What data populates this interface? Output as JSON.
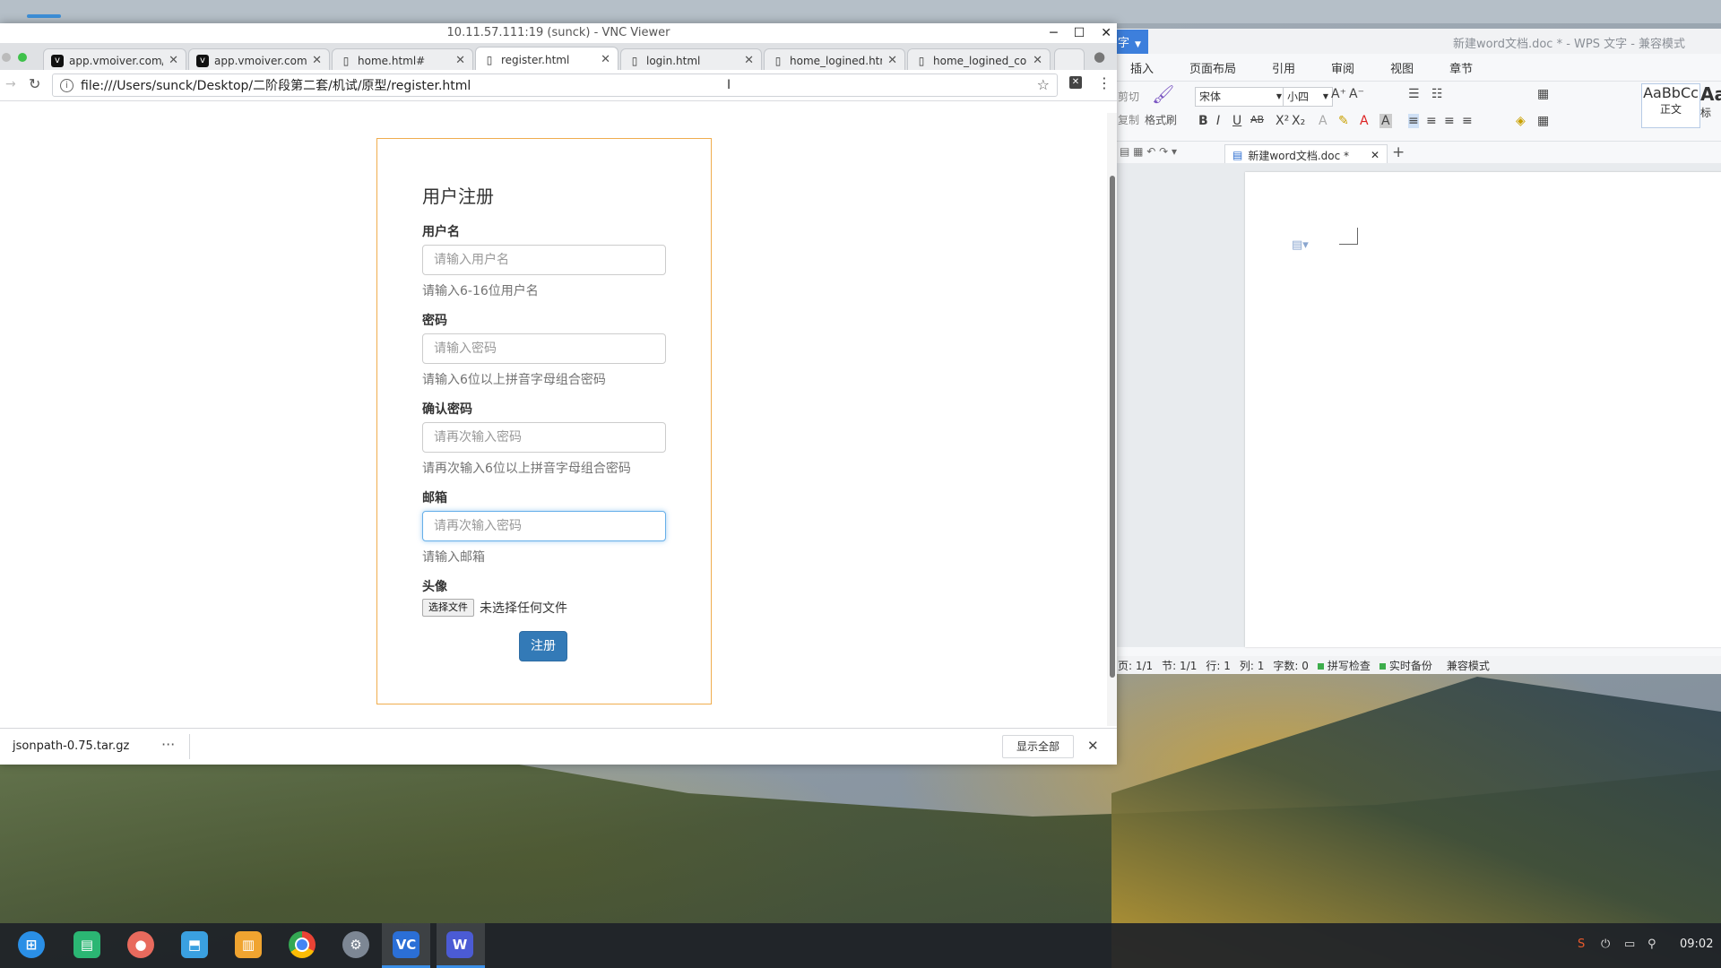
{
  "vnc_window": {
    "title": "10.11.57.111:19 (sunck) - VNC Viewer",
    "controls": [
      "─",
      "☐",
      "✕"
    ]
  },
  "browser": {
    "tabs": [
      {
        "label": "app.vmoiver.com/a",
        "favicon": "v-icon"
      },
      {
        "label": "app.vmoiver.com/a",
        "favicon": "v-icon"
      },
      {
        "label": "home.html#",
        "favicon": "page-icon"
      },
      {
        "label": "register.html",
        "favicon": "page-icon",
        "active": true
      },
      {
        "label": "login.html",
        "favicon": "page-icon"
      },
      {
        "label": "home_logined.html",
        "favicon": "page-icon"
      },
      {
        "label": "home_logined_coll",
        "favicon": "page-icon"
      }
    ],
    "url": "file:///Users/sunck/Desktop/二阶段第二套/机试/原型/register.html"
  },
  "form": {
    "heading": "用户注册",
    "username_label": "用户名",
    "username_placeholder": "请输入用户名",
    "username_help": "请输入6-16位用户名",
    "password_label": "密码",
    "password_placeholder": "请输入密码",
    "password_help": "请输入6位以上拼音字母组合密码",
    "confirm_label": "确认密码",
    "confirm_placeholder": "请再次输入密码",
    "confirm_help": "请再次输入6位以上拼音字母组合密码",
    "email_label": "邮箱",
    "email_placeholder": "请再次输入密码",
    "email_help": "请输入邮箱",
    "avatar_label": "头像",
    "file_button": "选择文件",
    "file_status": "未选择任何文件",
    "submit_label": "注册"
  },
  "download_bar": {
    "filename": "jsonpath-0.75.tar.gz",
    "more": "···",
    "show_all": "显示全部",
    "close": "✕"
  },
  "wps": {
    "brand": "字",
    "doc_title": "新建word文档.doc * - WPS 文字 - 兼容模式",
    "menu": [
      "插入",
      "页面布局",
      "引用",
      "审阅",
      "视图",
      "章节"
    ],
    "ribbon": {
      "cut": "剪切",
      "copy": "复制",
      "format_painter": "格式刷",
      "font_name": "宋体",
      "font_size": "小四",
      "style_sample": "AaBbCc",
      "style_name": "正文",
      "style_sample2": "Aa",
      "style_name2": "标"
    },
    "doc_tab": "新建word文档.doc *",
    "status": {
      "page": "页: 1/1",
      "section": "节: 1/1",
      "line": "行: 1",
      "col": "列: 1",
      "words": "字数: 0",
      "spell": "拼写检查",
      "backup": "实时备份",
      "compat": "兼容模式"
    }
  },
  "taskbar": {
    "clock": "09:02"
  },
  "colors": {
    "form_border": "#f0ad4e",
    "primary": "#337ab7",
    "focus": "#66afe9",
    "taskbar_active": "#3a8ee6"
  }
}
